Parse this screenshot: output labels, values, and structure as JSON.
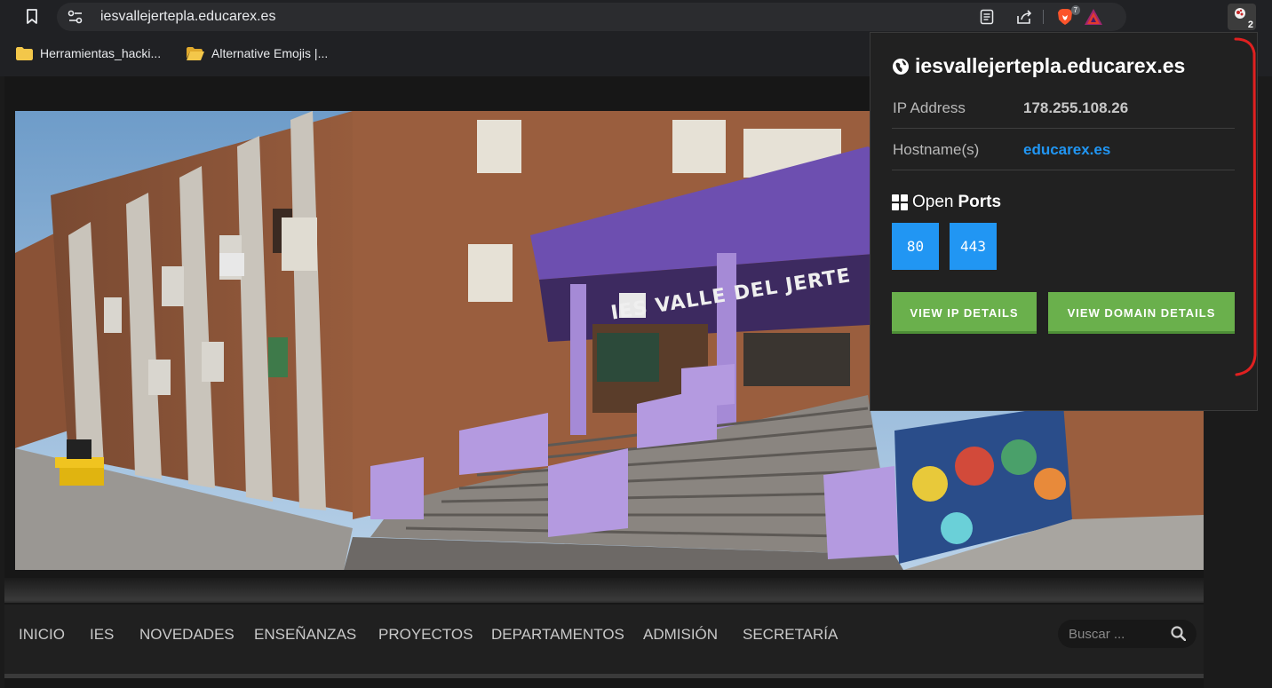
{
  "browser": {
    "url": "iesvallejertepla.educarex.es",
    "brave_badge_count": "7",
    "extension_count": "2",
    "bookmarks": [
      {
        "label": "Herramientas_hacki..."
      },
      {
        "label": "Alternative Emojis |..."
      }
    ]
  },
  "hero": {
    "sign_text": "IES VALLE DEL JERTE"
  },
  "nav": {
    "items": [
      "INICIO",
      "IES",
      "NOVEDADES",
      "ENSEÑANZAS",
      "PROYECTOS",
      "DEPARTAMENTOS",
      "ADMISIÓN",
      "SECRETARÍA"
    ],
    "search_placeholder": "Buscar ..."
  },
  "popup": {
    "domain": "iesvallejertepla.educarex.es",
    "ip_label": "IP Address",
    "ip_value": "178.255.108.26",
    "hostname_label": "Hostname(s)",
    "hostname_value": "educarex.es",
    "ports_title_light": "Open",
    "ports_title_bold": "Ports",
    "ports": [
      "80",
      "443"
    ],
    "btn_ip": "VIEW IP DETAILS",
    "btn_domain": "VIEW DOMAIN DETAILS",
    "link_color": "#2196f3",
    "button_color": "#6ab04c"
  }
}
